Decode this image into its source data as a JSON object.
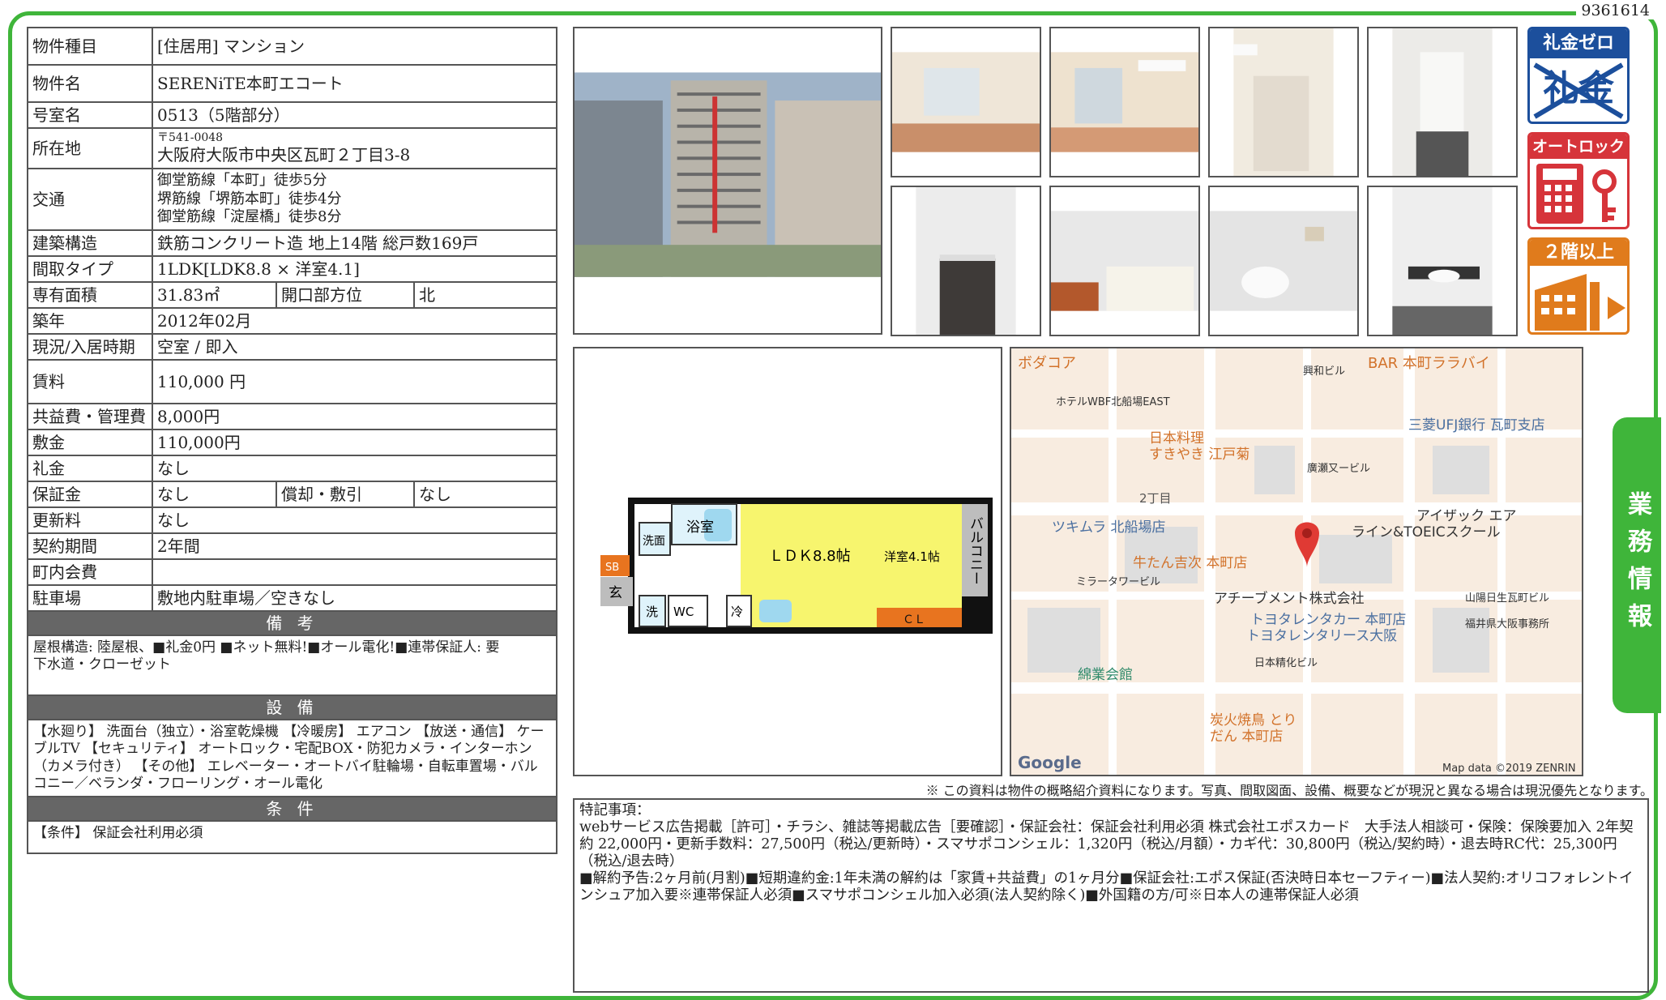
{
  "doc_id": "9361614",
  "property": {
    "type_label": "物件種目",
    "type_value": "[住居用]  マンション",
    "name_label": "物件名",
    "name_value": "SERENiTE本町エコート",
    "room_label": "号室名",
    "room_value": "0513（5階部分）",
    "address_label": "所在地",
    "postal": "〒541-0048",
    "address_value": "大阪府大阪市中央区瓦町２丁目3-8",
    "transport_label": "交通",
    "transport_1": "御堂筋線「本町」徒歩5分",
    "transport_2": "堺筋線「堺筋本町」徒歩4分",
    "transport_3": "御堂筋線「淀屋橋」徒歩8分",
    "structure_label": "建築構造",
    "structure_value": "鉄筋コンクリート造 地上14階 総戸数169戸",
    "layout_label": "間取タイプ",
    "layout_value": "1LDK[LDK8.8 × 洋室4.1]",
    "area_label": "専有面積",
    "area_value": "31.83㎡",
    "opening_label": "開口部方位",
    "opening_value": "北",
    "built_label": "築年",
    "built_value": "2012年02月",
    "status_label": "現況/入居時期",
    "status_value": "空室 / 即入",
    "rent_label": "賃料",
    "rent_value": "110,000 円",
    "fee_label": "共益費・管理費",
    "fee_value": "8,000円",
    "deposit_label": "敷金",
    "deposit_value": "110,000円",
    "keymoney_label": "礼金",
    "keymoney_value": "なし",
    "guarantee_label": "保証金",
    "guarantee_value": "なし",
    "amort_label": "償却・敷引",
    "amort_value": "なし",
    "renewal_label": "更新料",
    "renewal_value": "なし",
    "contract_label": "契約期間",
    "contract_value": "2年間",
    "community_label": "町内会費",
    "community_value": "",
    "parking_label": "駐車場",
    "parking_value": "敷地内駐車場／空きなし"
  },
  "sections": {
    "notes_title": "備 考",
    "notes_line1": "屋根構造:  陸屋根、■礼金0円  ■ネット無料!■オール電化!■連帯保証人: 要",
    "notes_line2": "下水道・クローゼット",
    "equip_title": "設 備",
    "equip_text": "【水廻り】 洗面台（独立）・浴室乾燥機 【冷暖房】 エアコン 【放送・通信】 ケーブルTV 【セキュリティ】 オートロック・宅配BOX・防犯カメラ・インターホン（カメラ付き） 【その他】 エレベーター・オートバイ駐輪場・自転車置場・バルコニー／ベランダ・フローリング・オール電化",
    "cond_title": "条 件",
    "cond_text": "【条件】 保証会社利用必須"
  },
  "badges": {
    "reikin_zero_top": "礼金ゼロ",
    "reikin_zero_crossed": "礼金",
    "autolock": "オートロック",
    "floor2": "２階以上"
  },
  "side_tab": "業務情報",
  "floorplan": {
    "bath": "浴室",
    "wash": "洗面",
    "sb": "SB",
    "entrance": "玄",
    "ldk": "ＬＤＫ8.8帖",
    "western": "洋室4.1帖",
    "balcony": "バルコニー",
    "cl": "ＣＬ",
    "washer": "洗",
    "wc": "WC",
    "fridge": "冷"
  },
  "map": {
    "labels": [
      "ボダコア",
      "ホテルWBF北船場EAST",
      "興和ビル",
      "BAR 本町ララバイ",
      "三菱UFJ銀行 瓦町支店",
      "日本料理",
      "すきやき 江戸菊",
      "廣瀬又ービル",
      "2丁目",
      "ツキムラ 北船場店",
      "アイザック エア",
      "ライン&TOEICスクール",
      "牛たん吉次 本町店",
      "ミラータワービル",
      "アチーブメント株式会社",
      "山陽日生瓦町ビル",
      "トヨタレンタカー 本町店",
      "トヨタレンタリース大阪",
      "福井県大阪事務所",
      "綿業会館",
      "日本精化ビル",
      "炭火焼鳥 とり",
      "だん 本町店"
    ],
    "google": "Google",
    "copyright": "Map data ©2019 ZENRIN"
  },
  "disclaimer": "※ この資料は物件の概略紹介資料になります。写真、間取図面、設備、概要などが現況と異なる場合は現況優先となります。",
  "remarks": {
    "title": "特記事項：",
    "line1": "webサービス広告掲載［許可］・チラシ、雑誌等掲載広告［要確認］・保証会社：保証会社利用必須 株式会社エポスカード　大手法人相談可・保険：保険要加入 2年契約 22,000円・更新手数料：27,500円（税込/更新時）・スマサポコンシェル：1,320円（税込/月額）・カギ代：30,800円（税込/契約時）・退去時RC代：25,300円（税込/退去時）",
    "line2": "■解約予告:2ヶ月前(月割)■短期違約金:1年未満の解約は「家賃+共益費」の1ヶ月分■保証会社:エポス保証(否決時日本セーフティー)■法人契約:オリコフォレントインシュア加入要※連帯保証人必須■スマサポコンシェル加入必須(法人契約除く)■外国籍の方/可※日本人の連帯保証人必須"
  },
  "colors": {
    "frame": "#3fb53a",
    "badge_blue": "#1c4f9c",
    "badge_red": "#d6343a",
    "badge_orange": "#e07b1c",
    "section_gray": "#666666"
  }
}
